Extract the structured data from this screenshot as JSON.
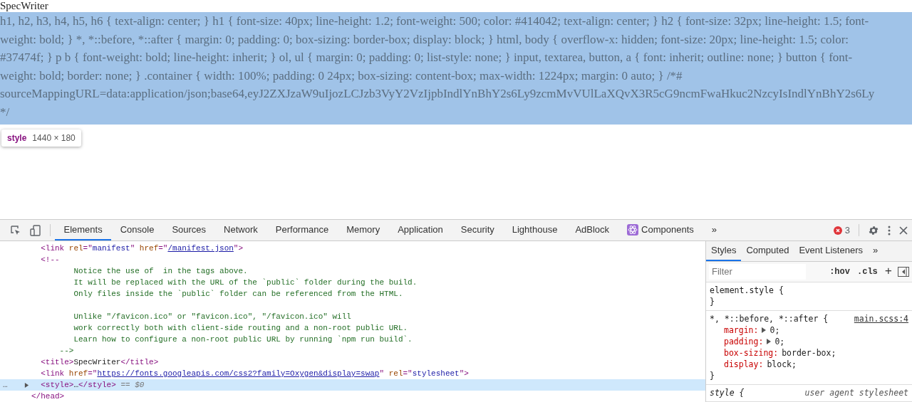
{
  "page": {
    "title": "SpecWriter",
    "style_lines": [
      "h1, h2, h3, h4, h5, h6 { text-align: center; } h1 { font-size: 40px; line-height: 1.2; font-weight: 500; color: #414042; text-align: center; } h2 { font-size: 32px; line-height: 1.5; font-",
      "weight: bold; } *, *::before, *::after { margin: 0; padding: 0; box-sizing: border-box; display: block; } html, body { overflow-x: hidden; font-size: 20px; line-height: 1.5; color:",
      "#37474f; } p b { font-weight: bold; line-height: inherit; } ol, ul { margin: 0; padding: 0; list-style: none; } input, textarea, button, a { font: inherit; outline: none; } button { font-",
      "weight: bold; border: none; } .container { width: 100%; padding: 0 24px; box-sizing: content-box; max-width: 1224px; margin: 0 auto; } /*#",
      "sourceMappingURL=data:application/json;base64,eyJ2ZXJzaW9uIjozLCJzb3VyY2VzIjpbIndlYnBhY2s6Ly9zcmMvVUlLaXQvX3R5cG9ncmFwaHkuc2NzcyIsIndlYnBhY2s6Ly",
      "*/"
    ],
    "tooltip": {
      "tag": "style",
      "size": "1440 × 180"
    }
  },
  "devtools": {
    "tabs": [
      {
        "label": "Elements",
        "selected": true,
        "kind": "plain"
      },
      {
        "label": "Console",
        "selected": false,
        "kind": "plain"
      },
      {
        "label": "Sources",
        "selected": false,
        "kind": "plain"
      },
      {
        "label": "Network",
        "selected": false,
        "kind": "plain"
      },
      {
        "label": "Performance",
        "selected": false,
        "kind": "plain"
      },
      {
        "label": "Memory",
        "selected": false,
        "kind": "plain"
      },
      {
        "label": "Application",
        "selected": false,
        "kind": "plain"
      },
      {
        "label": "Security",
        "selected": false,
        "kind": "plain"
      },
      {
        "label": "Lighthouse",
        "selected": false,
        "kind": "plain"
      },
      {
        "label": "AdBlock",
        "selected": false,
        "kind": "plain"
      },
      {
        "label": "Components",
        "selected": false,
        "kind": "react"
      }
    ],
    "more": "»",
    "error_count": "3",
    "dom": {
      "children": [
        {
          "selected": false,
          "tokens": [
            {
              "kind": "tag",
              "text": "<link "
            },
            {
              "kind": "attr",
              "text": "rel"
            },
            {
              "kind": "tag",
              "text": "=\""
            },
            {
              "kind": "value",
              "text": "manifest"
            },
            {
              "kind": "tag",
              "text": "\" "
            },
            {
              "kind": "attr",
              "text": "href"
            },
            {
              "kind": "tag",
              "text": "=\""
            },
            {
              "kind": "link",
              "text": "/manifest.json"
            },
            {
              "kind": "tag",
              "text": "\">"
            }
          ]
        },
        {
          "selected": false,
          "tokens": [
            {
              "kind": "tag",
              "text": "<!--"
            }
          ],
          "children": [
            {
              "selected": false,
              "kind": "comment_text",
              "tokens": [
                {
                  "kind": "comment",
                  "text": "Notice the use of  in the tags above."
                }
              ]
            },
            {
              "selected": false,
              "kind": "comment_text",
              "tokens": [
                {
                  "kind": "comment",
                  "text": "It will be replaced with the URL of the `public` folder during the build."
                }
              ]
            },
            {
              "selected": false,
              "kind": "comment_text",
              "tokens": [
                {
                  "kind": "comment",
                  "text": "Only files inside the `public` folder can be referenced from the HTML."
                }
              ]
            },
            {
              "selected": false,
              "kind": "comment_text",
              "paragraph_break": true,
              "tokens": [
                {
                  "kind": "comment",
                  "text": "Unlike \"/favicon.ico\" or \"favicon.ico\", \"/favicon.ico\" will"
                }
              ]
            },
            {
              "selected": false,
              "kind": "comment_text",
              "tokens": [
                {
                  "kind": "comment",
                  "text": "work correctly both with client-side routing and a non-root public URL."
                }
              ]
            },
            {
              "selected": false,
              "kind": "comment_text",
              "tokens": [
                {
                  "kind": "comment",
                  "text": "Learn how to configure a non-root public URL by running `npm run build`."
                }
              ]
            },
            {
              "selected": false,
              "kind": "comment_close",
              "tokens": [
                {
                  "kind": "comment",
                  "text": "-->"
                }
              ]
            }
          ]
        },
        {
          "selected": false,
          "tokens": [
            {
              "kind": "tag",
              "text": "<title>"
            },
            {
              "kind": "text",
              "text": "SpecWriter"
            },
            {
              "kind": "tag",
              "text": "</title>"
            }
          ]
        },
        {
          "selected": false,
          "tokens": [
            {
              "kind": "tag",
              "text": "<link "
            },
            {
              "kind": "attr",
              "text": "href"
            },
            {
              "kind": "tag",
              "text": "=\""
            },
            {
              "kind": "link",
              "text": "https://fonts.googleapis.com/css2?family=Oxygen&display=swap"
            },
            {
              "kind": "tag",
              "text": "\" "
            },
            {
              "kind": "attr",
              "text": "rel"
            },
            {
              "kind": "tag",
              "text": "=\""
            },
            {
              "kind": "value",
              "text": "stylesheet"
            },
            {
              "kind": "tag",
              "text": "\">"
            }
          ]
        },
        {
          "selected": true,
          "gutter": "…",
          "expanded": false,
          "tokens": [
            {
              "kind": "tag",
              "text": "<style>"
            },
            {
              "kind": "text",
              "text": "…"
            },
            {
              "kind": "tag",
              "text": "</style>"
            },
            {
              "kind": "marker",
              "text": " == $0"
            }
          ]
        }
      ],
      "close_tokens": [
        {
          "kind": "tag",
          "text": "</head>"
        }
      ]
    },
    "side_tabs": [
      {
        "label": "Styles",
        "selected": true
      },
      {
        "label": "Computed",
        "selected": false
      },
      {
        "label": "Event Listeners",
        "selected": false
      }
    ],
    "side_more": "»",
    "filter": {
      "placeholder": "Filter"
    },
    "hov": ":hov",
    "cls": ".cls",
    "plus": "+",
    "rules": [
      {
        "selector": "element.style {",
        "close": "}"
      },
      {
        "selector": "*, *::before, *::after {",
        "source": "main.scss:4",
        "source_link": true,
        "decls": [
          {
            "prop": "margin:",
            "value": "0;",
            "expand": true
          },
          {
            "prop": "padding:",
            "value": "0;",
            "expand": true
          },
          {
            "prop": "box-sizing:",
            "value": "border-box;",
            "expand": false
          },
          {
            "prop": "display:",
            "value": "block;",
            "expand": false
          }
        ],
        "close": "}"
      },
      {
        "selector": "style {",
        "source": "user agent stylesheet",
        "source_link": false
      }
    ]
  }
}
